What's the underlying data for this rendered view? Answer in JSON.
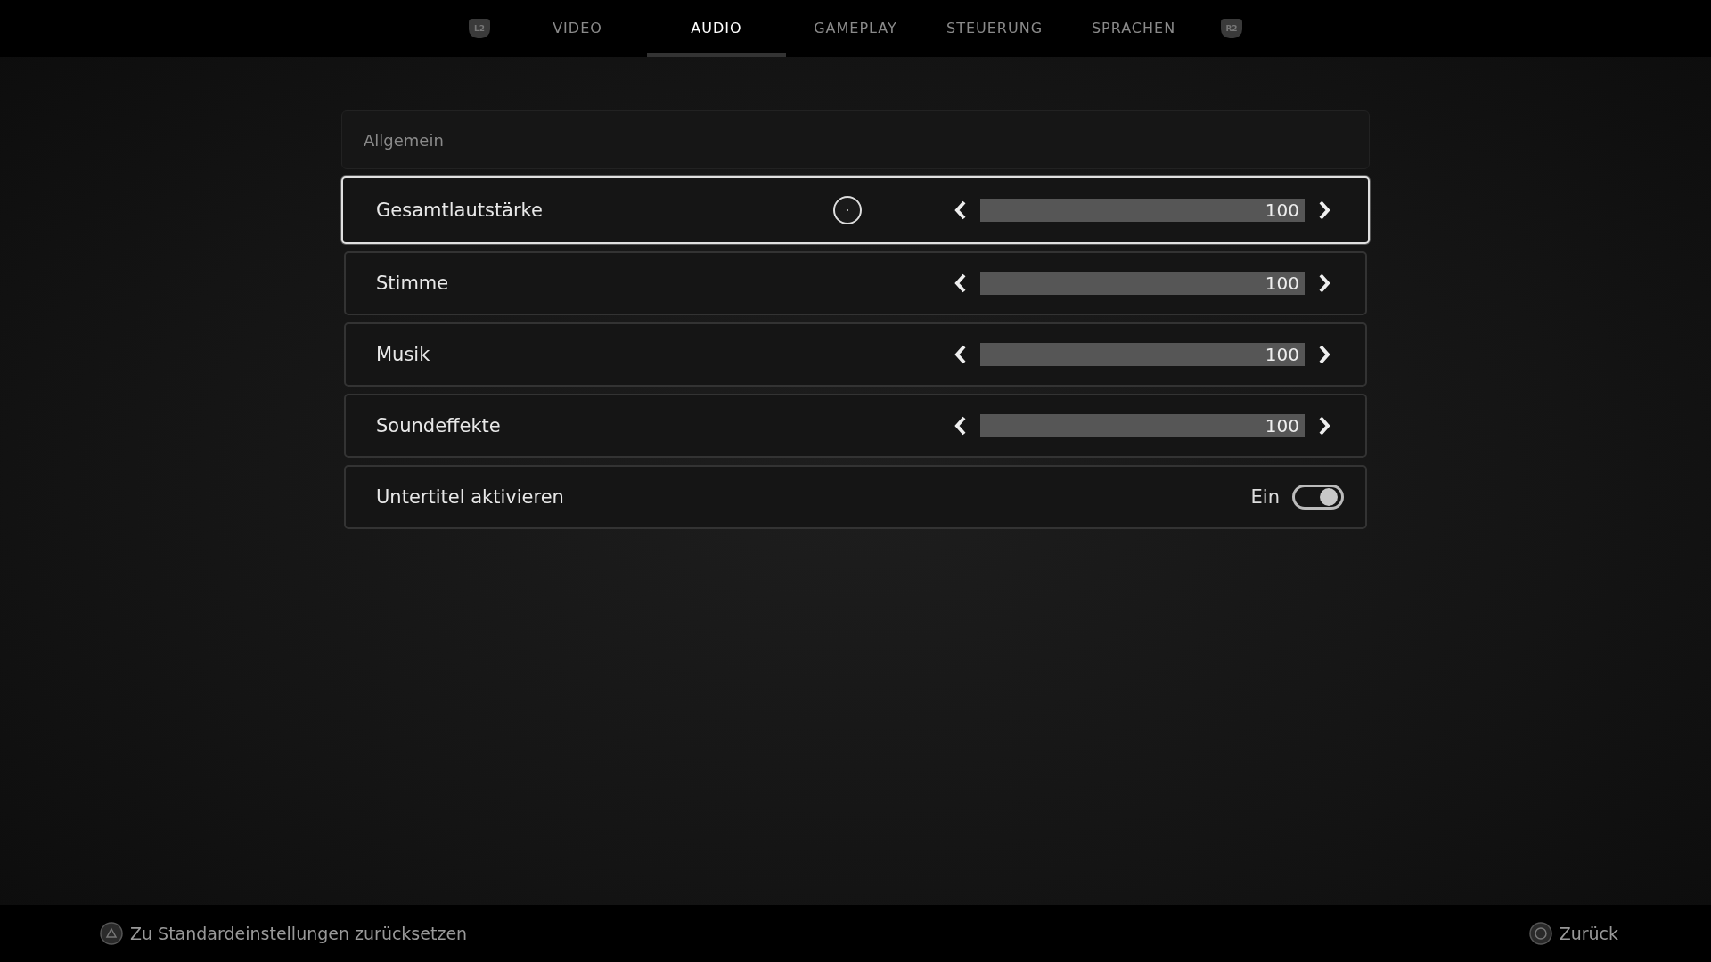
{
  "tabs_bar": {
    "left_badge": "L2",
    "right_badge": "R2",
    "tabs": [
      {
        "label": "VIDEO",
        "selected": false
      },
      {
        "label": "AUDIO",
        "selected": true
      },
      {
        "label": "GAMEPLAY",
        "selected": false
      },
      {
        "label": "STEUERUNG",
        "selected": false
      },
      {
        "label": "SPRACHEN",
        "selected": false
      }
    ]
  },
  "section": {
    "title": "Allgemein",
    "rows": [
      {
        "kind": "slider",
        "label": "Gesamtlautstärke",
        "selected": true,
        "level": 1,
        "reading": "100"
      },
      {
        "kind": "slider",
        "label": "Stimme",
        "selected": false,
        "level": 1,
        "reading": "100"
      },
      {
        "kind": "slider",
        "label": "Musik",
        "selected": false,
        "level": 1,
        "reading": "100"
      },
      {
        "kind": "slider",
        "label": "Soundeffekte",
        "selected": false,
        "level": 1,
        "reading": "100"
      },
      {
        "kind": "toggle",
        "label": "Untertitel aktivieren",
        "selected": false,
        "on": true,
        "value": "Ein"
      }
    ]
  },
  "footer": {
    "reset": "Zu Standardeinstellungen zurücksetzen",
    "back": "Zurück"
  }
}
